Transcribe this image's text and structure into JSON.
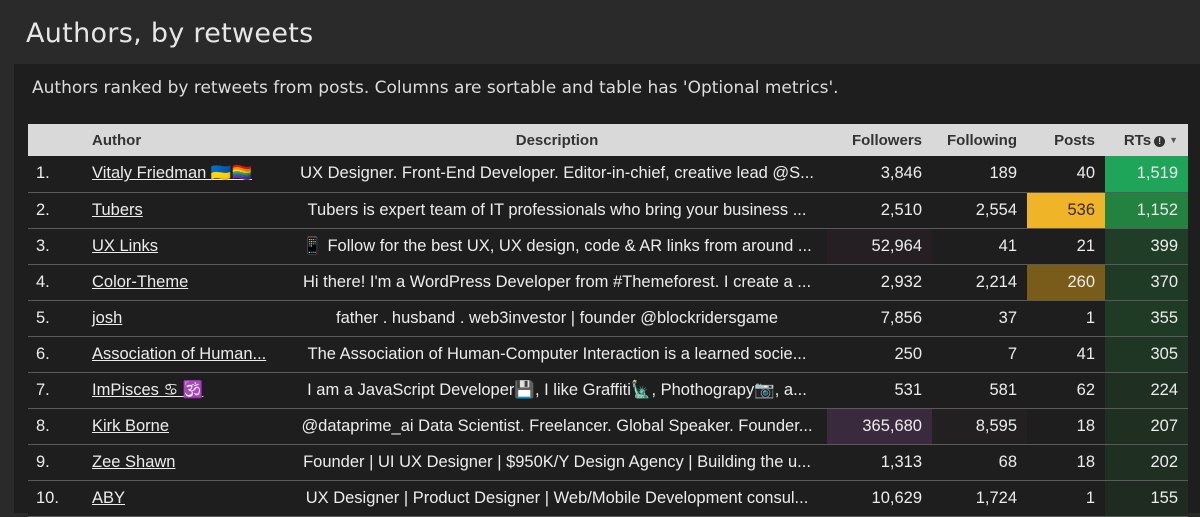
{
  "page": {
    "title": "Authors, by retweets",
    "subtitle": "Authors ranked by retweets from posts. Columns are sortable and table has 'Optional metrics'."
  },
  "table": {
    "columns": {
      "rank": "",
      "author": "Author",
      "description": "Description",
      "followers": "Followers",
      "following": "Following",
      "posts": "Posts",
      "rts": "RTs"
    },
    "rows": [
      {
        "rank": "1.",
        "author": "Vitaly Friedman 🇺🇦🏳️‍🌈",
        "description": "UX Designer. Front-End Developer. Editor-in-chief, creative lead @S...",
        "followers": "3,846",
        "following": "189",
        "posts": "40",
        "rts": "1,519",
        "followers_bg": "#1e1e1e",
        "following_bg": "#1e1e1e",
        "posts_bg": "#1e1e1e",
        "rts_bg": "#1ea55a"
      },
      {
        "rank": "2.",
        "author": "Tubers",
        "description": "Tubers is expert team of IT professionals who bring your business ...",
        "followers": "2,510",
        "following": "2,554",
        "posts": "536",
        "rts": "1,152",
        "followers_bg": "#1e1e1e",
        "following_bg": "#1e1e1e",
        "posts_bg": "#f0b429",
        "posts_color": "#3a2a00",
        "rts_bg": "#23823f"
      },
      {
        "rank": "3.",
        "author": "UX Links",
        "description": "📱 Follow for the best UX, UX design, code & AR links from around ...",
        "followers": "52,964",
        "following": "41",
        "posts": "21",
        "rts": "399",
        "followers_bg": "#251f24",
        "following_bg": "#1e1e1e",
        "posts_bg": "#1e1e1e",
        "rts_bg": "#1f3d27"
      },
      {
        "rank": "4.",
        "author": "Color-Theme",
        "description": "Hi there! I'm a WordPress Developer from #Themeforest. I create a ...",
        "followers": "2,932",
        "following": "2,214",
        "posts": "260",
        "rts": "370",
        "followers_bg": "#1e1e1e",
        "following_bg": "#1e1e1e",
        "posts_bg": "#7a5c1a",
        "rts_bg": "#1f3b26"
      },
      {
        "rank": "5.",
        "author": "josh",
        "description": "father . husband . web3investor | founder @blockridersgame",
        "followers": "7,856",
        "following": "37",
        "posts": "1",
        "rts": "355",
        "followers_bg": "#1e1e1e",
        "following_bg": "#1e1e1e",
        "posts_bg": "#1e1e1e",
        "rts_bg": "#1f3a25"
      },
      {
        "rank": "6.",
        "author": "Association of Human...",
        "description": "The Association of Human-Computer Interaction is a learned socie...",
        "followers": "250",
        "following": "7",
        "posts": "41",
        "rts": "305",
        "followers_bg": "#1e1e1e",
        "following_bg": "#1e1e1e",
        "posts_bg": "#1e1e1e",
        "rts_bg": "#1f3624"
      },
      {
        "rank": "7.",
        "author": "ImPisces ♋ 🕉️",
        "description": "I am a JavaScript Developer💾, I like Graffiti🗽, Phothograpy📷, a...",
        "followers": "531",
        "following": "581",
        "posts": "62",
        "rts": "224",
        "followers_bg": "#1e1e1e",
        "following_bg": "#1e1e1e",
        "posts_bg": "#1e1e1e",
        "rts_bg": "#1f3022"
      },
      {
        "rank": "8.",
        "author": "Kirk Borne",
        "description": "@dataprime_ai Data Scientist. Freelancer. Global Speaker. Founder...",
        "followers": "365,680",
        "following": "8,595",
        "posts": "18",
        "rts": "207",
        "followers_bg": "#3a2a3d",
        "following_bg": "#222021",
        "posts_bg": "#1e1e1e",
        "rts_bg": "#1f2f22"
      },
      {
        "rank": "9.",
        "author": "Zee Shawn",
        "description": "Founder | UI UX Designer | $950K/Y Design Agency | Building the u...",
        "followers": "1,313",
        "following": "68",
        "posts": "18",
        "rts": "202",
        "followers_bg": "#1e1e1e",
        "following_bg": "#1e1e1e",
        "posts_bg": "#1e1e1e",
        "rts_bg": "#1f2f22"
      },
      {
        "rank": "10.",
        "author": "ABY",
        "description": "UX Designer | Product Designer | Web/Mobile Development consul...",
        "followers": "10,629",
        "following": "1,724",
        "posts": "1",
        "rts": "155",
        "followers_bg": "#1e1e1e",
        "following_bg": "#1e1e1e",
        "posts_bg": "#1e1e1e",
        "rts_bg": "#1f2a21"
      }
    ]
  }
}
